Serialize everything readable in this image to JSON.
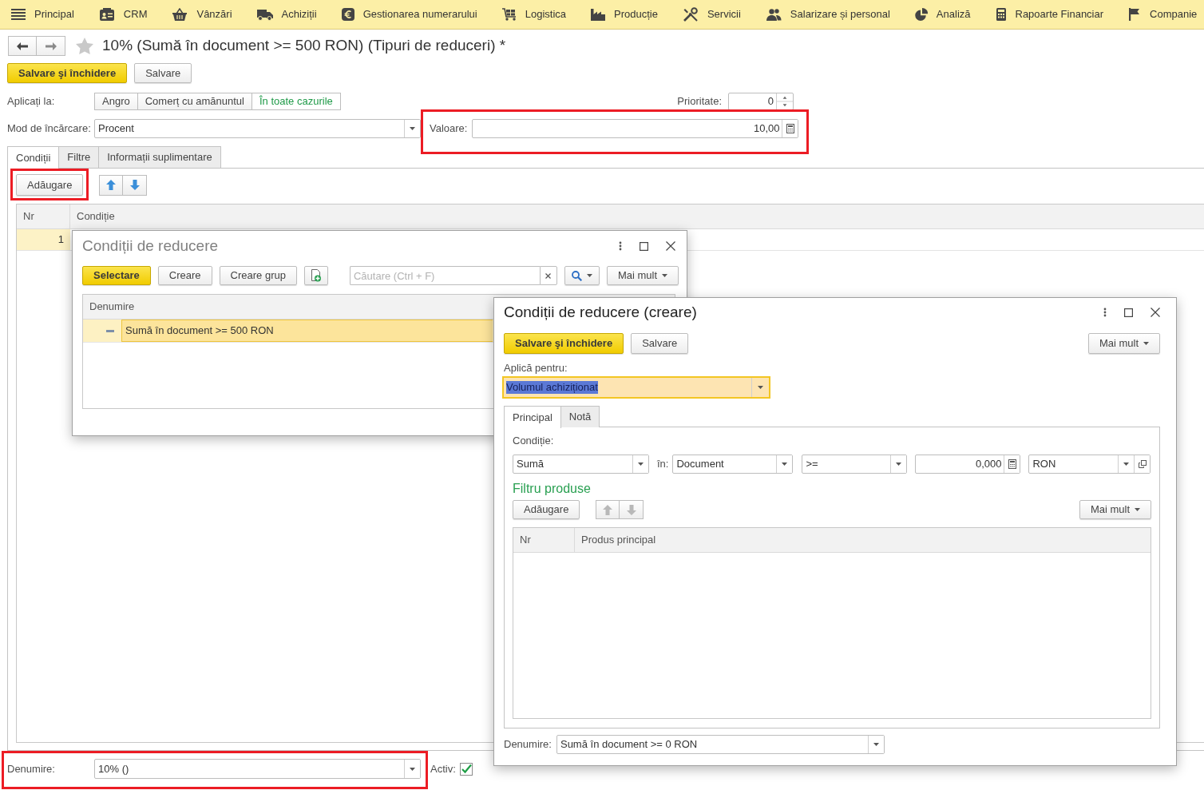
{
  "menu_bar": {
    "items": [
      {
        "label": "Principal"
      },
      {
        "label": "CRM"
      },
      {
        "label": "Vânzări"
      },
      {
        "label": "Achiziții"
      },
      {
        "label": "Gestionarea numerarului"
      },
      {
        "label": "Logistica"
      },
      {
        "label": "Producție"
      },
      {
        "label": "Servicii"
      },
      {
        "label": "Salarizare și personal"
      },
      {
        "label": "Analiză"
      },
      {
        "label": "Rapoarte Financiar"
      },
      {
        "label": "Companie"
      }
    ]
  },
  "window": {
    "title": "10% (Sumă în document >= 500 RON) (Tipuri de reduceri) *",
    "favorite": false
  },
  "toolbar": {
    "buttons": [
      {
        "label": "Salvare şi închidere",
        "kind": "primary"
      },
      {
        "label": "Salvare",
        "kind": "default"
      }
    ]
  },
  "form": {
    "apply_to": {
      "label": "Aplicați la:",
      "options": [
        {
          "label": "Angro",
          "selected": false
        },
        {
          "label": "Comerț cu amănuntul",
          "selected": false
        },
        {
          "label": "În toate cazurile",
          "selected": true
        }
      ]
    },
    "priority": {
      "label": "Prioritate:",
      "value": "0"
    },
    "charge_mode": {
      "label": "Mod de încărcare:",
      "value": "Procent"
    },
    "value": {
      "label": "Valoare:",
      "value": "10,00",
      "highlighted": true
    }
  },
  "tabs": [
    {
      "label": "Condiții",
      "selected": true
    },
    {
      "label": "Filtre",
      "selected": false
    },
    {
      "label": "Informații suplimentare",
      "selected": false
    }
  ],
  "conditions": {
    "add_button": {
      "label": "Adăugare",
      "highlighted": true
    },
    "reorder_disabled": false,
    "table": {
      "columns": [
        "Nr",
        "Condiție"
      ],
      "rows": [
        {
          "nr": "1",
          "selected": true
        }
      ]
    }
  },
  "footer": {
    "name": {
      "label": "Denumire:",
      "value": "10% ()",
      "highlighted": true
    },
    "active": {
      "label": "Activ:",
      "checked": true
    }
  },
  "picker_dialog": {
    "title": "Condiții de reducere",
    "active": false,
    "buttons": [
      {
        "label": "Selectare",
        "kind": "primary"
      },
      {
        "label": "Creare",
        "kind": "default"
      },
      {
        "label": "Creare grup",
        "kind": "default"
      }
    ],
    "search": {
      "placeholder": "Căutare (Ctrl + F)"
    },
    "more_button": {
      "label": "Mai mult"
    },
    "list": {
      "columns": [
        "Denumire"
      ],
      "rows": [
        {
          "name": "Sumă în document >= 500 RON",
          "selected": true
        }
      ]
    }
  },
  "create_dialog": {
    "title": "Condiții de reducere (creare)",
    "active": true,
    "buttons": [
      {
        "label": "Salvare şi închidere",
        "kind": "primary"
      },
      {
        "label": "Salvare",
        "kind": "default"
      }
    ],
    "more_button": {
      "label": "Mai mult"
    },
    "apply_for": {
      "label": "Aplică pentru:",
      "value": "Volumul achiziționat",
      "focused": true
    },
    "tabs": [
      {
        "label": "Principal",
        "selected": true
      },
      {
        "label": "Notă",
        "selected": false
      }
    ],
    "condition": {
      "label": "Condiție:",
      "measure": "Sumă",
      "in_label": "în:",
      "scope": "Document",
      "operator": ">=",
      "amount": "0,000",
      "currency": "RON"
    },
    "product_filter": {
      "title": "Filtru produse",
      "add_button": {
        "label": "Adăugare"
      },
      "reorder_disabled": true,
      "more_button": {
        "label": "Mai mult"
      },
      "table": {
        "columns": [
          "Nr",
          "Produs principal"
        ]
      }
    },
    "name": {
      "label": "Denumire:",
      "value": "Sumă în document >= 0 RON"
    }
  }
}
